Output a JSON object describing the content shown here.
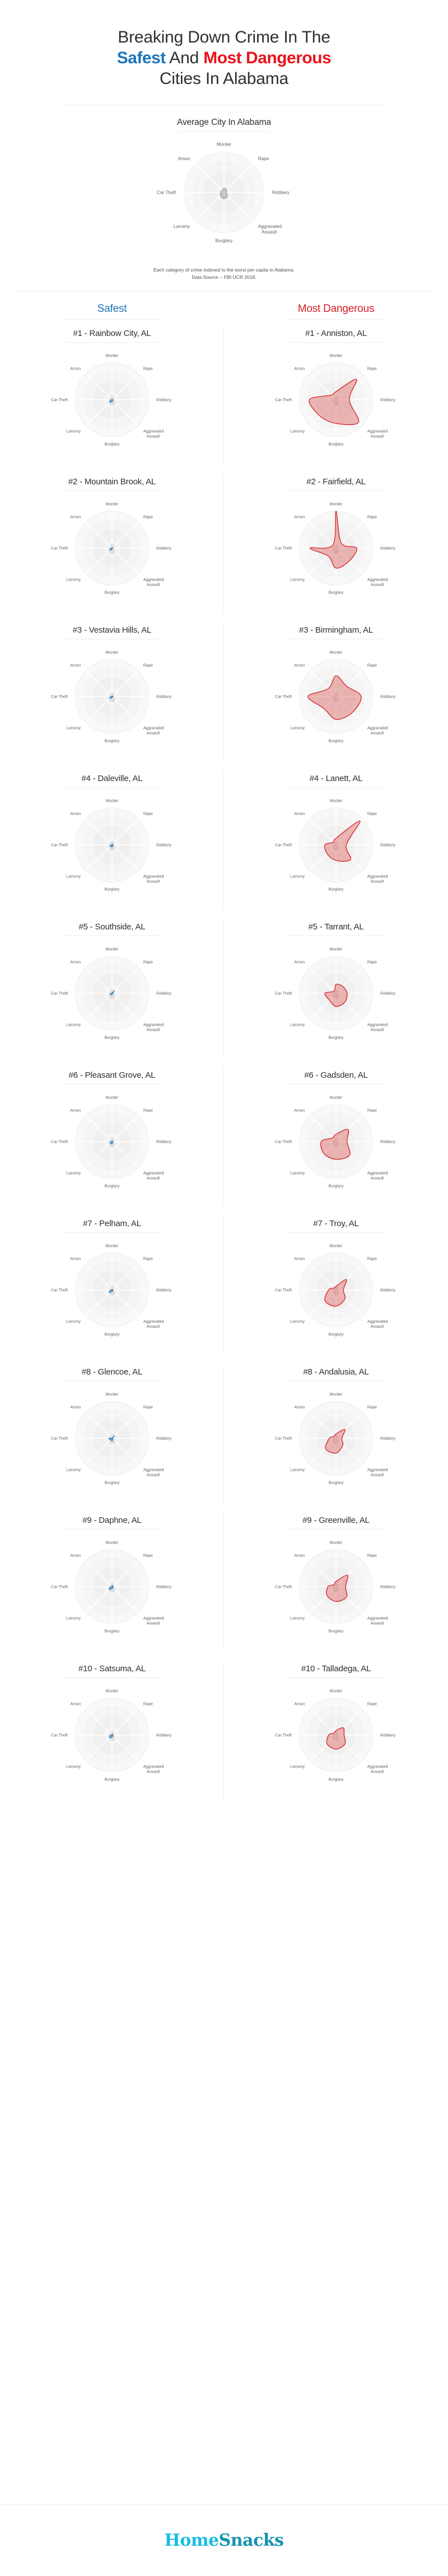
{
  "header": {
    "line1": "Breaking Down Crime In The",
    "safest_word": "Safest",
    "and_word": " And ",
    "dangerous_word": "Most Dangerous",
    "line3": "Cities In Alabama"
  },
  "average": {
    "title": "Average City In Alabama"
  },
  "caption": {
    "line1": "Each category of crime indexed to the worst per capita in Alabama.",
    "line2": "Data Source -- FBI UCR 2018."
  },
  "columns": {
    "safest_label": "Safest",
    "dangerous_label": "Most Dangerous"
  },
  "colors": {
    "safe_accent": "#1b75bb",
    "danger_accent": "#d62027",
    "safe_fill": "#2f7fc1",
    "danger_fill": "#d9534f",
    "grid": "#e9e9e9",
    "avg_fill": "#9a9a9a",
    "logo_home": "#18bde0",
    "logo_snacks": "#1493ae"
  },
  "logo": {
    "home": "Home",
    "snacks": "Snacks"
  },
  "chart_data": {
    "type": "radar",
    "axes": [
      "Murder",
      "Rape",
      "Robbery",
      "Aggravated Assault",
      "Burglary",
      "Larceny",
      "Car Theft",
      "Arson"
    ],
    "axis_order_note": "clockwise starting at top",
    "scale": "0-100, indexed to worst per capita city in Alabama",
    "rings": [
      25,
      50,
      75,
      100
    ],
    "grid": true,
    "legend": "none",
    "title": "Breaking Down Crime In The Safest And Most Dangerous Cities In Alabama",
    "average": {
      "name": "Average City In Alabama",
      "values": [
        11,
        9,
        6,
        13,
        16,
        12,
        9,
        7
      ]
    },
    "safest": [
      {
        "rank": "#1",
        "name": "#1 - Rainbow City, AL",
        "values": [
          0,
          2,
          1,
          3,
          5,
          9,
          2,
          0
        ]
      },
      {
        "rank": "#2",
        "name": "#2 - Mountain Brook, AL",
        "values": [
          0,
          1,
          2,
          1,
          3,
          8,
          2,
          0
        ]
      },
      {
        "rank": "#3",
        "name": "#3 - Vestavia Hills, AL",
        "values": [
          0,
          2,
          2,
          2,
          3,
          7,
          3,
          0
        ]
      },
      {
        "rank": "#4",
        "name": "#4 - Daleville, AL",
        "values": [
          0,
          3,
          1,
          4,
          5,
          6,
          2,
          0
        ]
      },
      {
        "rank": "#5",
        "name": "#5 - Southside, AL",
        "values": [
          0,
          9,
          2,
          2,
          4,
          5,
          2,
          0
        ]
      },
      {
        "rank": "#6",
        "name": "#6 - Pleasant Grove, AL",
        "values": [
          0,
          2,
          2,
          3,
          6,
          6,
          3,
          0
        ]
      },
      {
        "rank": "#7",
        "name": "#7 - Pelham, AL",
        "values": [
          0,
          2,
          2,
          3,
          4,
          10,
          3,
          0
        ]
      },
      {
        "rank": "#8",
        "name": "#8 - Glencoe, AL",
        "values": [
          0,
          10,
          1,
          3,
          7,
          5,
          9,
          0
        ]
      },
      {
        "rank": "#9",
        "name": "#9 - Daphne, AL",
        "values": [
          0,
          4,
          2,
          4,
          5,
          11,
          3,
          0
        ]
      },
      {
        "rank": "#10",
        "name": "#10 - Satsuma, AL",
        "values": [
          0,
          3,
          2,
          3,
          6,
          9,
          4,
          0
        ]
      }
    ],
    "most_dangerous": [
      {
        "rank": "#1",
        "name": "#1 - Anniston, AL",
        "values": [
          22,
          78,
          36,
          86,
          64,
          62,
          72,
          18
        ]
      },
      {
        "rank": "#2",
        "name": "#2 - Fairfield, AL",
        "values": [
          100,
          20,
          56,
          50,
          54,
          30,
          70,
          12
        ]
      },
      {
        "rank": "#3",
        "name": "#3 - Birmingham, AL",
        "values": [
          56,
          40,
          68,
          62,
          62,
          46,
          76,
          30
        ]
      },
      {
        "rank": "#4",
        "name": "#4 - Lanett, AL",
        "values": [
          18,
          92,
          28,
          56,
          42,
          34,
          30,
          10
        ]
      },
      {
        "rank": "#5",
        "name": "#5 - Tarrant, AL",
        "values": [
          24,
          26,
          30,
          34,
          36,
          26,
          30,
          8
        ]
      },
      {
        "rank": "#6",
        "name": "#6 - Gadsden, AL",
        "values": [
          20,
          46,
          30,
          52,
          48,
          46,
          40,
          14
        ]
      },
      {
        "rank": "#7",
        "name": "#7 - Troy, AL",
        "values": [
          10,
          40,
          20,
          34,
          44,
          42,
          20,
          8
        ]
      },
      {
        "rank": "#8",
        "name": "#8 - Andalusia, AL",
        "values": [
          12,
          34,
          16,
          26,
          40,
          40,
          18,
          8
        ]
      },
      {
        "rank": "#9",
        "name": "#9 - Greenville, AL",
        "values": [
          14,
          44,
          26,
          40,
          40,
          34,
          22,
          8
        ]
      },
      {
        "rank": "#10",
        "name": "#10 - Talladega, AL",
        "values": [
          12,
          28,
          22,
          34,
          38,
          34,
          20,
          8
        ]
      }
    ]
  }
}
